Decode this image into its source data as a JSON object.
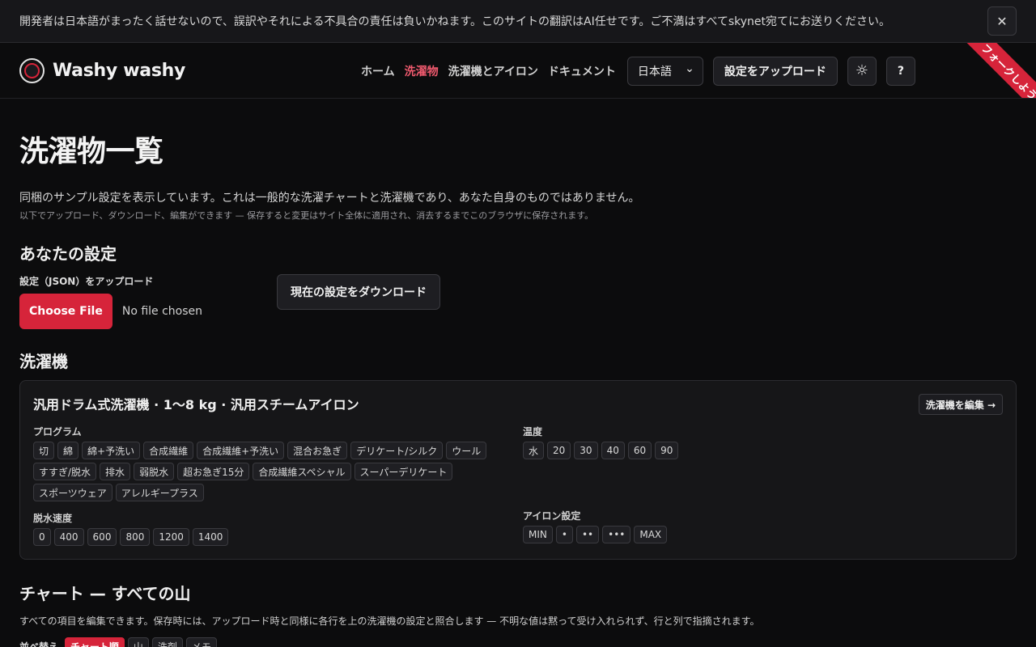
{
  "banner": {
    "text": "開発者は日本語がまったく話せないので、誤訳やそれによる不具合の責任は負いかねます。このサイトの翻訳はAI任せです。ご不満はすべてskynet宛てにお送りください。",
    "close_icon": "✕"
  },
  "header": {
    "brand": "Washy washy",
    "nav": [
      {
        "label": "ホーム",
        "active": false
      },
      {
        "label": "洗濯物",
        "active": true
      },
      {
        "label": "洗濯機とアイロン",
        "active": false
      },
      {
        "label": "ドキュメント",
        "active": false
      }
    ],
    "language": "日本語",
    "language_chevron": "⌄",
    "upload_settings": "設定をアップロード",
    "theme_icon": "☼",
    "help": "?",
    "ribbon": "フォークしよう"
  },
  "page": {
    "title": "洗濯物一覧",
    "intro": "同梱のサンプル設定を表示しています。これは一般的な洗濯チャートと洗濯機であり、あなた自身のものではありません。",
    "intro_sub": "以下でアップロード、ダウンロード、編集ができます — 保存すると変更はサイト全体に適用され、消去するまでこのブラウザに保存されます。"
  },
  "settings": {
    "heading": "あなたの設定",
    "upload_label": "設定（JSON）をアップロード",
    "choose_file": "Choose File",
    "no_file": "No file chosen",
    "download": "現在の設定をダウンロード"
  },
  "machine": {
    "heading": "洗濯機",
    "card_title": "汎用ドラム式洗濯機 · 1〜8 kg · 汎用スチームアイロン",
    "edit": "洗濯機を編集 →",
    "programs_label": "プログラム",
    "programs": [
      "切",
      "綿",
      "綿+予洗い",
      "合成繊維",
      "合成繊維+予洗い",
      "混合お急ぎ",
      "デリケート/シルク",
      "ウール",
      "すすぎ/脱水",
      "排水",
      "弱脱水",
      "超お急ぎ15分",
      "合成繊維スペシャル",
      "スーパーデリケート",
      "スポーツウェア",
      "アレルギープラス"
    ],
    "temp_label": "温度",
    "temps": [
      "水",
      "20",
      "30",
      "40",
      "60",
      "90"
    ],
    "spin_label": "脱水速度",
    "spins": [
      "0",
      "400",
      "600",
      "800",
      "1200",
      "1400"
    ],
    "iron_label": "アイロン設定",
    "irons": [
      "MIN",
      "•",
      "••",
      "•••",
      "MAX"
    ]
  },
  "chart": {
    "heading": "チャート — すべての山",
    "desc": "すべての項目を編集できます。保存時には、アップロード時と同様に各行を上の洗濯機の設定と照合します — 不明な値は黙って受け入れられず、行と列で指摘されます。",
    "sort_label": "並べ替え",
    "sort_options": [
      {
        "label": "チャート順",
        "active": true
      },
      {
        "label": "山",
        "active": false
      },
      {
        "label": "洗剤",
        "active": false
      },
      {
        "label": "メモ",
        "active": false
      }
    ]
  }
}
